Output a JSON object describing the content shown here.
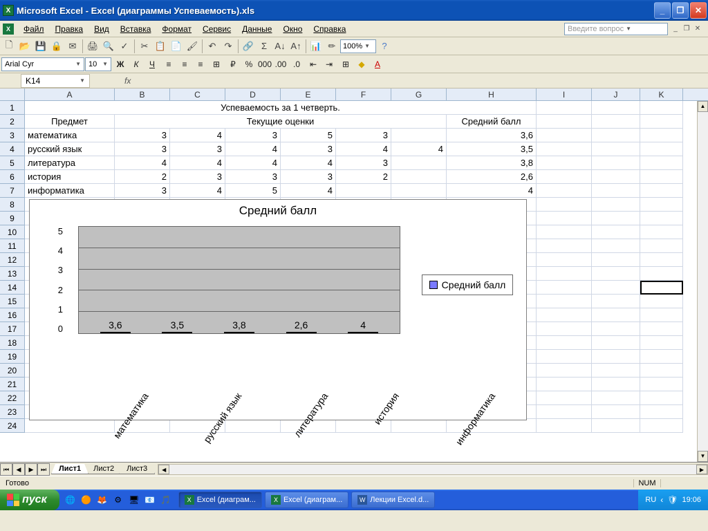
{
  "titlebar": {
    "title": "Microsoft Excel - Excel (диаграммы Успеваемость).xls"
  },
  "menu": {
    "file": "Файл",
    "edit": "Правка",
    "view": "Вид",
    "insert": "Вставка",
    "format": "Формат",
    "tools": "Сервис",
    "data": "Данные",
    "window": "Окно",
    "help": "Справка",
    "question_placeholder": "Введите вопрос"
  },
  "format": {
    "font": "Arial Cyr",
    "size": "10"
  },
  "toolbar": {
    "zoom": "100%"
  },
  "namebox": "K14",
  "cols": [
    "A",
    "B",
    "C",
    "D",
    "E",
    "F",
    "G",
    "H",
    "I",
    "J",
    "K"
  ],
  "rows_shown": 24,
  "cells": {
    "title_row": "Успеваемость за 1 четверть.",
    "h_subject": "Предмет",
    "h_grades": "Текущие оценки",
    "h_avg": "Средний балл",
    "r3": {
      "A": "математика",
      "B": "3",
      "C": "4",
      "D": "3",
      "E": "5",
      "F": "3",
      "H": "3,6"
    },
    "r4": {
      "A": "русский язык",
      "B": "3",
      "C": "3",
      "D": "4",
      "E": "3",
      "F": "4",
      "G": "4",
      "H": "3,5"
    },
    "r5": {
      "A": "литература",
      "B": "4",
      "C": "4",
      "D": "4",
      "E": "4",
      "F": "3",
      "H": "3,8"
    },
    "r6": {
      "A": "история",
      "B": "2",
      "C": "3",
      "D": "3",
      "E": "3",
      "F": "2",
      "H": "2,6"
    },
    "r7": {
      "A": "информатика",
      "B": "3",
      "C": "4",
      "D": "5",
      "E": "4",
      "H": "4"
    }
  },
  "chart_data": {
    "type": "bar",
    "title": "Средний балл",
    "categories": [
      "математика",
      "русский язык",
      "литература",
      "история",
      "информатика"
    ],
    "values": [
      3.6,
      3.5,
      3.8,
      2.6,
      4.0
    ],
    "value_labels": [
      "3,6",
      "3,5",
      "3,8",
      "2,6",
      "4"
    ],
    "ylim": [
      0,
      5
    ],
    "yticks": [
      0,
      1,
      2,
      3,
      4,
      5
    ],
    "legend": "Средний балл"
  },
  "sheet_tabs": {
    "s1": "Лист1",
    "s2": "Лист2",
    "s3": "Лист3"
  },
  "status": {
    "ready": "Готово",
    "num": "NUM"
  },
  "taskbar": {
    "start": "пуск",
    "task1": "Excel (диаграм...",
    "task2": "Excel (диаграм...",
    "task3": "Лекции Excel.d...",
    "lang": "RU",
    "time": "19:06"
  }
}
